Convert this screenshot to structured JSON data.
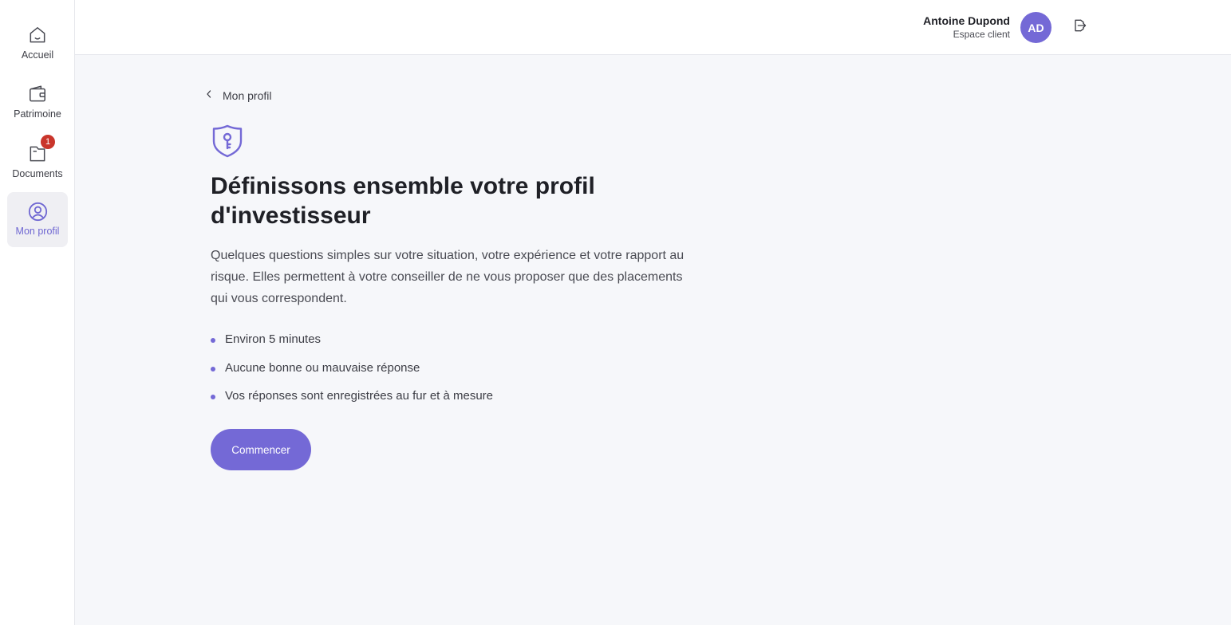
{
  "sidebar": {
    "items": [
      {
        "label": "Accueil",
        "icon": "home-icon"
      },
      {
        "label": "Patrimoine",
        "icon": "wallet-icon"
      },
      {
        "label": "Documents",
        "icon": "document-icon",
        "badge": "1"
      },
      {
        "label": "Mon profil",
        "icon": "user-circle-icon",
        "active": true
      }
    ]
  },
  "header": {
    "user_name": "Antoine Dupond",
    "user_role": "Espace client",
    "avatar_initials": "AD",
    "logout_icon": "logout-icon"
  },
  "main": {
    "back_label": "Mon profil",
    "title": "Définissons ensemble votre profil d'investisseur",
    "intro": "Quelques questions simples sur votre situation, votre expérience et votre rapport au risque. Elles permettent à votre conseiller de ne vous proposer que des placements qui vous correspondent.",
    "bullets": [
      "Environ 5 minutes",
      "Aucune bonne ou mauvaise réponse",
      "Vos réponses sont enregistrées au fur et à mesure"
    ],
    "start_label": "Commencer"
  },
  "colors": {
    "accent": "#7469d6",
    "badge": "#c9352b",
    "background": "#f6f7fa"
  }
}
